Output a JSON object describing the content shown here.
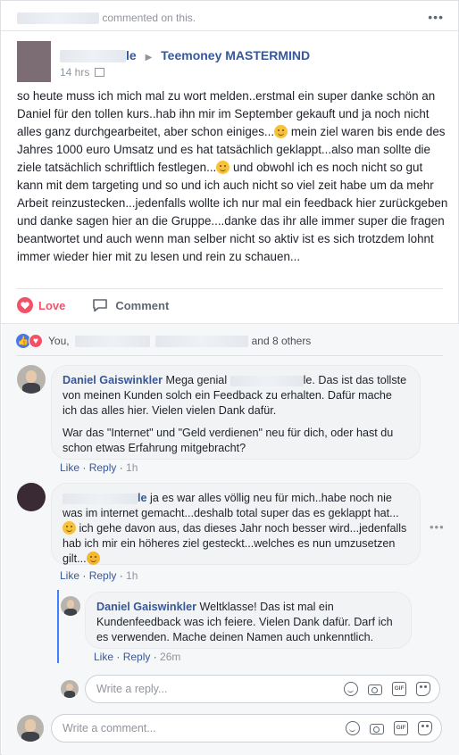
{
  "notification": {
    "suffix": "commented on this."
  },
  "post": {
    "group": "Teemoney MASTERMIND",
    "author_suffix": "le",
    "time": "14 hrs",
    "text_parts": [
      "so heute muss ich mich mal zu wort melden..erstmal ein super danke schön an Daniel für den tollen kurs..hab ihn mir im September gekauft und ja noch nicht alles ganz durchgearbeitet, aber schon einiges...",
      " mein ziel waren bis ende des Jahres 1000 euro Umsatz und es hat tatsächlich geklappt...also man sollte die ziele tatsächlich schriftlich festlegen...",
      " und obwohl ich es noch nicht so gut kann mit dem targeting und so und ich auch nicht so viel zeit habe um da mehr Arbeit reinzustecken...jedenfalls wollte ich nur mal ein feedback hier zurückgeben und danke sagen hier an die Gruppe....danke das ihr alle immer super die fragen beantwortet und auch wenn man selber nicht so aktiv ist es sich trotzdem lohnt immer wieder hier mit zu lesen und rein zu schauen..."
    ]
  },
  "actions": {
    "love": "Love",
    "comment": "Comment"
  },
  "reactions": {
    "you": "You,",
    "others": "and 8 others"
  },
  "comments": [
    {
      "name": "Daniel Gaiswinkler",
      "text_a": "Mega genial",
      "text_b": "le. Das ist das tollste von meinen Kunden solch ein Feedback zu erhalten. Dafür mache ich das alles hier. Vielen vielen Dank dafür.",
      "text_c": "War das \"Internet\" und \"Geld verdienen\" neu für dich, oder hast du schon etwas Erfahrung mitgebracht?",
      "like": "Like",
      "reply": "Reply",
      "time": "1h"
    },
    {
      "name_suffix": "le",
      "text_a": " ja es war alles völlig neu für mich..habe noch nie was im internet gemacht...deshalb total super das es geklappt hat...",
      "text_b": " ich gehe davon aus, das dieses Jahr noch besser wird...jedenfalls hab ich mir ein höheres ziel gesteckt...welches es nun umzusetzen gilt...",
      "like": "Like",
      "reply": "Reply",
      "time": "1h"
    }
  ],
  "reply": {
    "name": "Daniel Gaiswinkler",
    "text": "Weltklasse! Das ist mal ein Kundenfeedback was ich feiere. Vielen Dank dafür. Darf ich es verwenden. Mache deinen Namen auch unkenntlich.",
    "like": "Like",
    "reply": "Reply",
    "time": "26m"
  },
  "inputs": {
    "reply_placeholder": "Write a reply...",
    "comment_placeholder": "Write a comment...",
    "gif_label": "GIF"
  },
  "colors": {
    "link": "#365899",
    "love": "#f25268",
    "like": "#4a76e8",
    "reply_line": "#4080ff"
  }
}
